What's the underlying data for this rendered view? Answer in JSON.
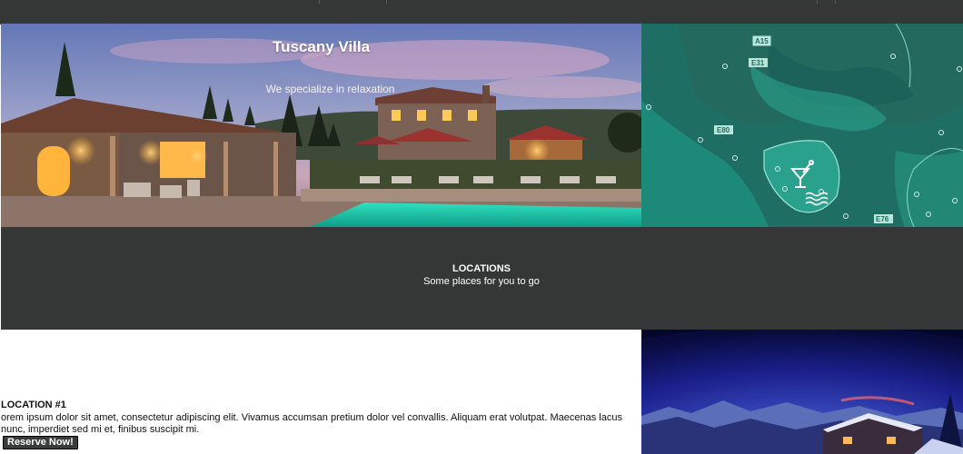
{
  "hero": {
    "title": "Tuscany Villa",
    "subtitle": "We specialize in relaxation"
  },
  "map": {
    "road_labels": [
      "A15",
      "E31",
      "E80",
      "E76"
    ],
    "icons": [
      "cocktail-icon",
      "waves-icon"
    ]
  },
  "locations": {
    "title": "LOCATIONS",
    "subtitle": "Some places for you to go"
  },
  "location1": {
    "title": "LOCATION #1",
    "body": "orem ipsum dolor sit amet, consectetur adipiscing elit. Vivamus accumsan pretium dolor vel convallis. Aliquam erat volutpat. Maecenas lacus nunc, imperdiet sed mi et, finibus suscipit mi.",
    "button_label": "Reserve Now!"
  },
  "colors": {
    "dark_band": "#353737",
    "map_sea": "#1d8a79",
    "map_land": "#1f6e63"
  }
}
